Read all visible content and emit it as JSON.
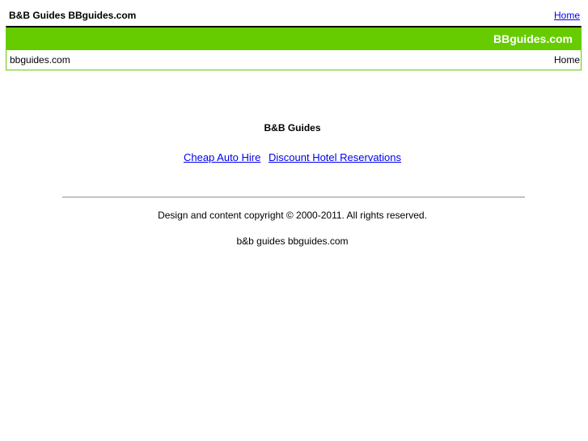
{
  "header": {
    "site_title": "B&B Guides BBguides.com",
    "home_link": "Home"
  },
  "banner": {
    "brand_text": "BBguides.com",
    "color": "#66cc00"
  },
  "subbar": {
    "domain": "bbguides.com",
    "home_label": "Home"
  },
  "main": {
    "heading": "B&B Guides",
    "links": [
      {
        "label": "Cheap Auto Hire"
      },
      {
        "label": "Discount Hotel Reservations"
      }
    ]
  },
  "footer": {
    "copyright": "Design and content copyright © 2000-2011. All rights reserved.",
    "tagline": "b&b guides bbguides.com"
  }
}
